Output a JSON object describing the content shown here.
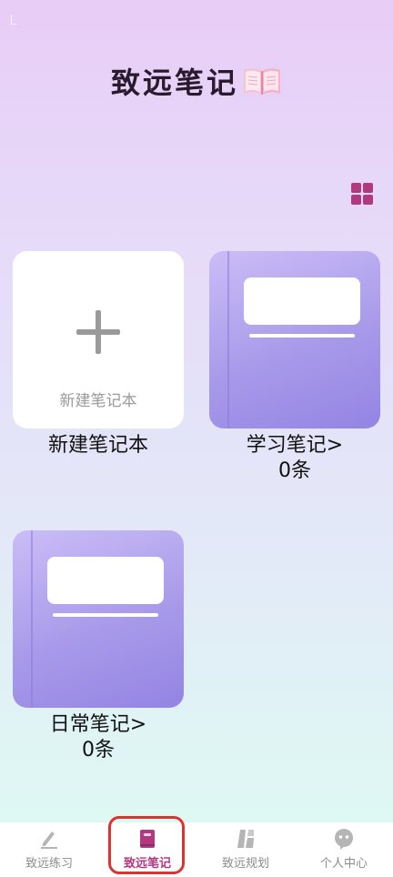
{
  "header": {
    "title": "致远笔记"
  },
  "notebooks": {
    "new": {
      "inner_label": "新建笔记本",
      "caption": "新建笔记本"
    },
    "items": [
      {
        "name": "学习笔记>",
        "count": "0条"
      },
      {
        "name": "日常笔记>",
        "count": "0条"
      }
    ]
  },
  "tabbar": {
    "tabs": [
      {
        "label": "致远练习",
        "icon": "pen-icon",
        "active": false
      },
      {
        "label": "致远笔记",
        "icon": "notebook-icon",
        "active": true
      },
      {
        "label": "致远规划",
        "icon": "blocks-icon",
        "active": false
      },
      {
        "label": "个人中心",
        "icon": "chat-bubble-icon",
        "active": false
      }
    ]
  },
  "colors": {
    "accent": "#b0397f",
    "card_purple": "#a89ae9",
    "tab_inactive": "#8c8c8c",
    "highlight": "#e03131"
  }
}
